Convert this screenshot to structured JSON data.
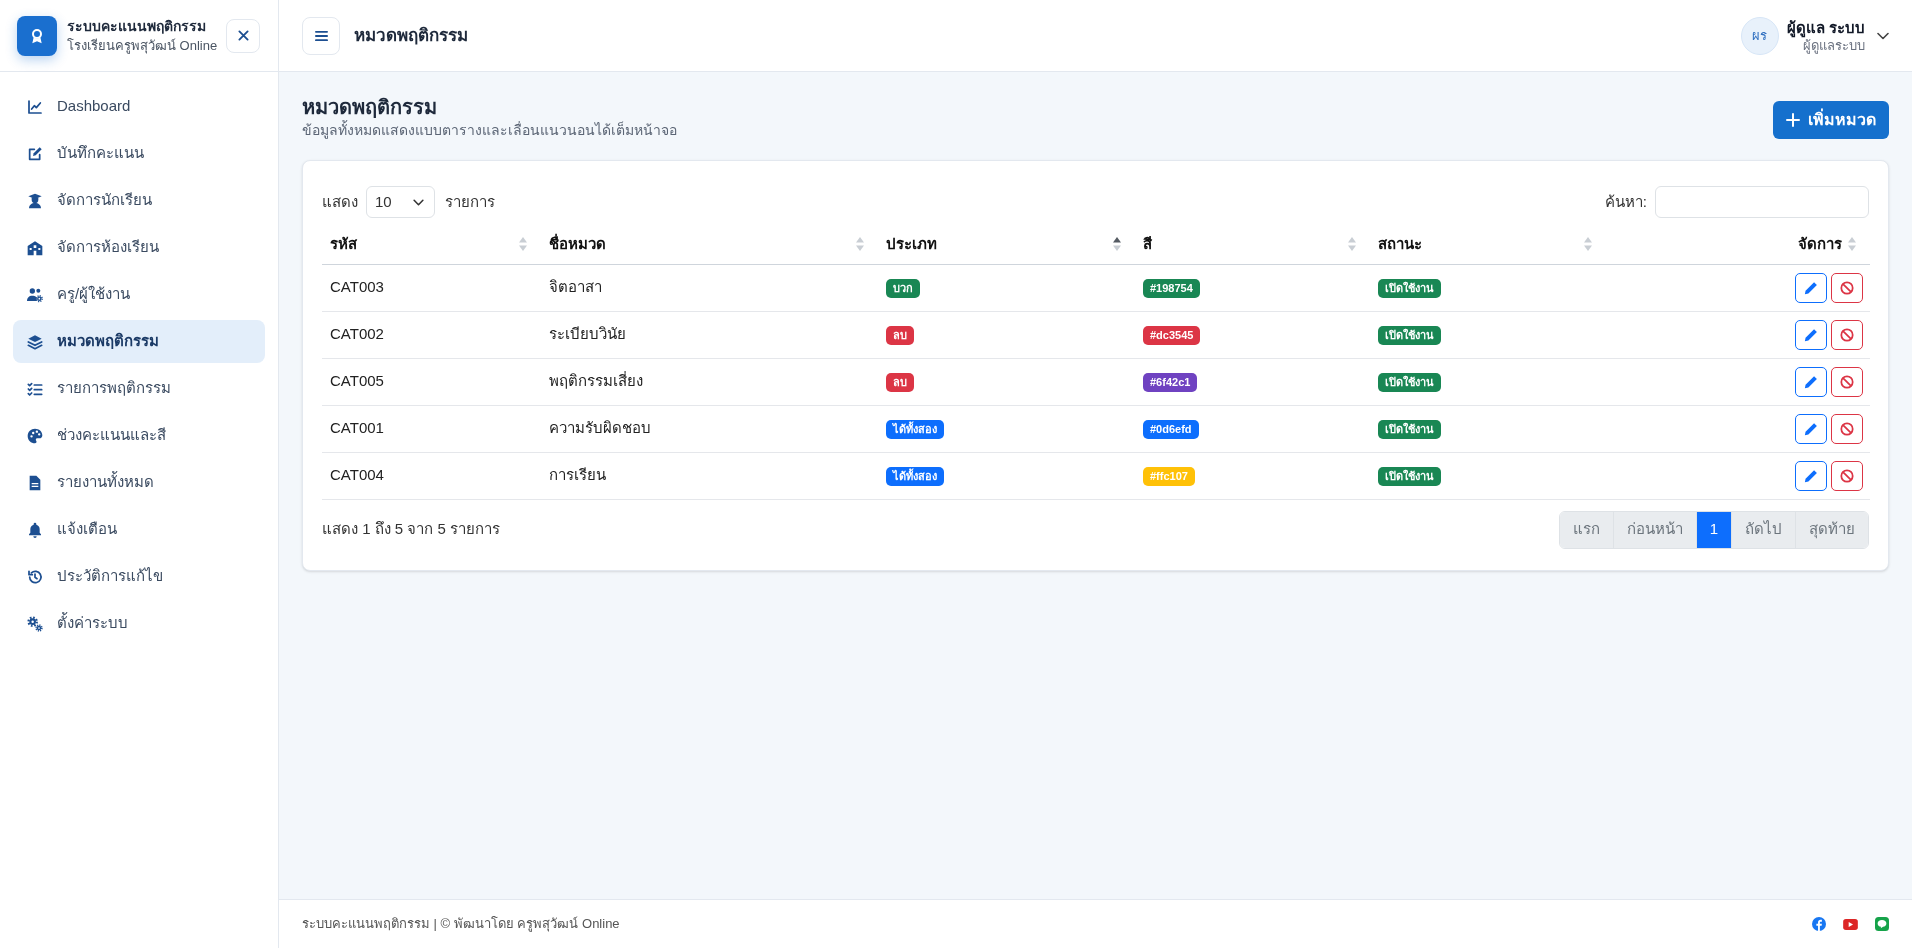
{
  "sidebar": {
    "title": "ระบบคะแนนพฤติกรรม",
    "subtitle": "โรงเรียนครูพสุวัฒน์ Online",
    "items": [
      {
        "label": "Dashboard",
        "selected": false
      },
      {
        "label": "บันทึกคะแนน",
        "selected": false
      },
      {
        "label": "จัดการนักเรียน",
        "selected": false
      },
      {
        "label": "จัดการห้องเรียน",
        "selected": false
      },
      {
        "label": "ครู/ผู้ใช้งาน",
        "selected": false
      },
      {
        "label": "หมวดพฤติกรรม",
        "selected": true
      },
      {
        "label": "รายการพฤติกรรม",
        "selected": false
      },
      {
        "label": "ช่วงคะแนนและสี",
        "selected": false
      },
      {
        "label": "รายงานทั้งหมด",
        "selected": false
      },
      {
        "label": "แจ้งเตือน",
        "selected": false
      },
      {
        "label": "ประวัติการแก้ไข",
        "selected": false
      },
      {
        "label": "ตั้งค่าระบบ",
        "selected": false
      }
    ]
  },
  "header": {
    "title": "หมวดพฤติกรรม",
    "user": {
      "initials": "ผร",
      "name": "ผู้ดูแล ระบบ",
      "role": "ผู้ดูแลระบบ"
    }
  },
  "page": {
    "title": "หมวดพฤติกรรม",
    "subtitle": "ข้อมูลทั้งหมดแสดงแบบตารางและเลื่อนแนวนอนได้เต็มหน้าจอ",
    "add_button": "เพิ่มหมวด"
  },
  "table": {
    "length_label": "แสดง",
    "length_value": "10",
    "length_suffix": "รายการ",
    "search_label": "ค้นหา:",
    "columns": [
      {
        "label": "รหัส",
        "sorted": false
      },
      {
        "label": "ชื่อหมวด",
        "sorted": false
      },
      {
        "label": "ประเภท",
        "sorted": true
      },
      {
        "label": "สี",
        "sorted": false
      },
      {
        "label": "สถานะ",
        "sorted": false
      },
      {
        "label": "จัดการ",
        "sorted": false
      }
    ],
    "rows": [
      {
        "code": "CAT003",
        "name": "จิตอาสา",
        "type": {
          "kind": "positive",
          "label": "บวก"
        },
        "color": "#198754",
        "color_label": "#198754",
        "status": {
          "label": "เปิดใช้งาน",
          "active": true
        }
      },
      {
        "code": "CAT002",
        "name": "ระเบียบวินัย",
        "type": {
          "kind": "negative",
          "label": "ลบ"
        },
        "color": "#dc3545",
        "color_label": "#dc3545",
        "status": {
          "label": "เปิดใช้งาน",
          "active": true
        }
      },
      {
        "code": "CAT005",
        "name": "พฤติกรรมเสี่ยง",
        "type": {
          "kind": "negative",
          "label": "ลบ"
        },
        "color": "#6f42c1",
        "color_label": "#6f42c1",
        "status": {
          "label": "เปิดใช้งาน",
          "active": true
        }
      },
      {
        "code": "CAT001",
        "name": "ความรับผิดชอบ",
        "type": {
          "kind": "both",
          "label": "ได้ทั้งสอง"
        },
        "color": "#0d6efd",
        "color_label": "#0d6efd",
        "status": {
          "label": "เปิดใช้งาน",
          "active": true
        }
      },
      {
        "code": "CAT004",
        "name": "การเรียน",
        "type": {
          "kind": "both",
          "label": "ได้ทั้งสอง"
        },
        "color": "#ffc107",
        "color_label": "#ffc107",
        "status": {
          "label": "เปิดใช้งาน",
          "active": true
        }
      }
    ],
    "info": "แสดง 1 ถึง 5 จาก 5 รายการ",
    "pagination": [
      {
        "label": "แรก",
        "selected": false,
        "disabled": true
      },
      {
        "label": "ก่อนหน้า",
        "selected": false,
        "disabled": true
      },
      {
        "label": "1",
        "selected": true,
        "disabled": false
      },
      {
        "label": "ถัดไป",
        "selected": false,
        "disabled": true
      },
      {
        "label": "สุดท้าย",
        "selected": false,
        "disabled": true
      }
    ]
  },
  "footer": {
    "text": "ระบบคะแนนพฤติกรรม | © พัฒนาโดย ครูพสุวัฒน์ Online"
  }
}
